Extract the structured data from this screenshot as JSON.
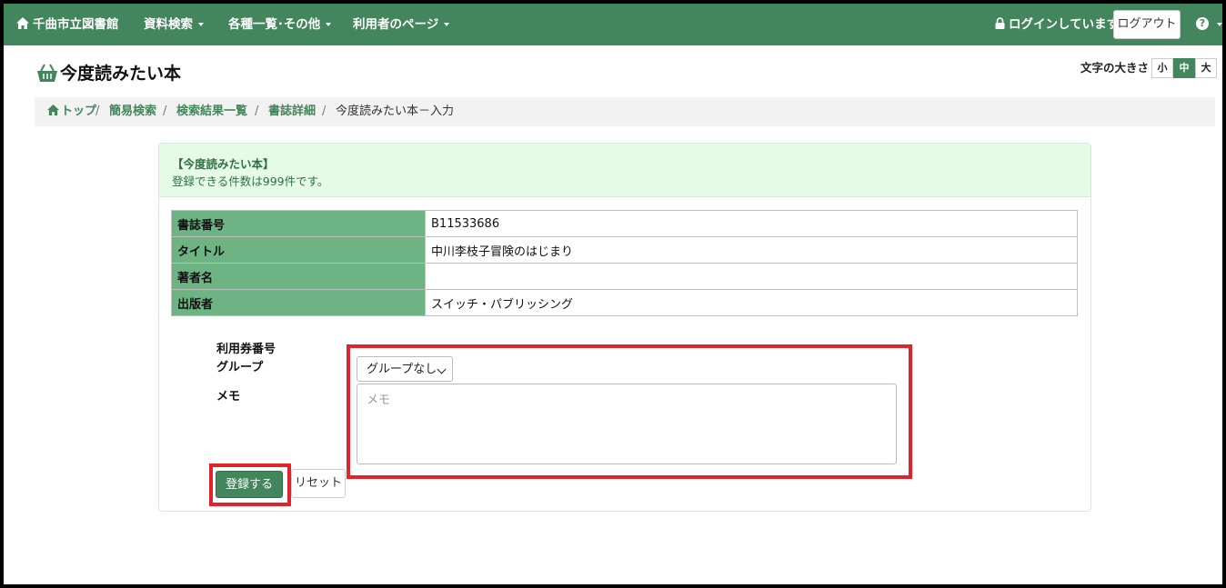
{
  "nav": {
    "home_label": "千曲市立図書館",
    "menu": [
      "資料検索",
      "各種一覧･その他",
      "利用者のページ"
    ],
    "login_status": "ログインしています",
    "logout_label": "ログアウト",
    "help_symbol": "?"
  },
  "page": {
    "title": "今度読みたい本",
    "font_size_label": "文字の大きさ",
    "font_sizes": [
      "小",
      "中",
      "大"
    ],
    "font_size_selected": "中"
  },
  "breadcrumb": {
    "items": [
      "トップ",
      "簡易検索",
      "検索結果一覧",
      "書誌詳細"
    ],
    "current": "今度読みたい本－入力",
    "separator": "/"
  },
  "panel": {
    "title": "【今度読みたい本】",
    "note": "登録できる件数は999件です。"
  },
  "book": {
    "rows": [
      {
        "key": "書誌番号",
        "value": "B11533686"
      },
      {
        "key": "タイトル",
        "value": "中川李枝子冒険のはじまり"
      },
      {
        "key": "著者名",
        "value": ""
      },
      {
        "key": "出版者",
        "value": "スイッチ・パブリッシング"
      }
    ]
  },
  "form": {
    "card_label": "利用券番号",
    "group_label": "グループ",
    "memo_label": "メモ",
    "group_value": "グループなし",
    "memo_placeholder": "メモ",
    "submit_label": "登録する",
    "reset_label": "リセット"
  },
  "colors": {
    "primary": "#43855c",
    "table_header": "#6db383",
    "highlight": "#e0242b"
  }
}
